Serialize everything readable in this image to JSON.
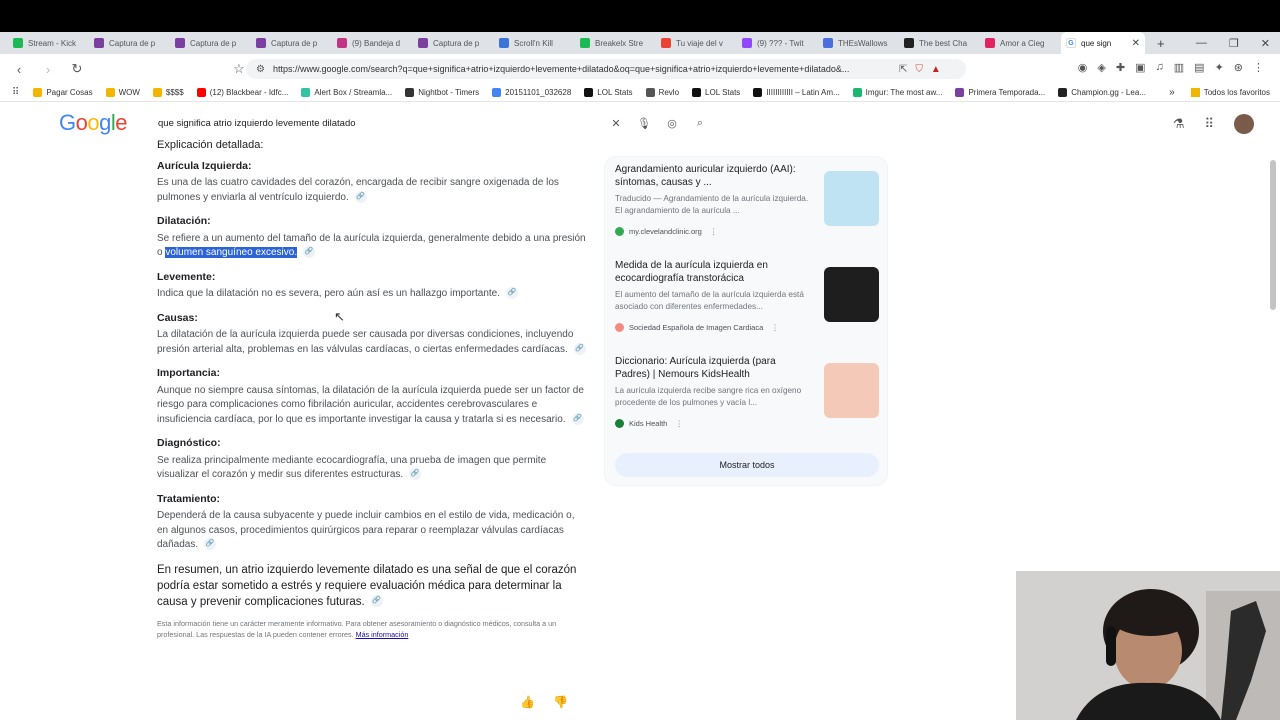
{
  "browser": {
    "tabs": [
      {
        "label": "Stream - Kick",
        "color": "#1db954"
      },
      {
        "label": "Captura de p",
        "color": "#7b3fa0"
      },
      {
        "label": "Captura de p",
        "color": "#7b3fa0"
      },
      {
        "label": "Captura de p",
        "color": "#7b3fa0"
      },
      {
        "label": "(9) Bandeja d",
        "color": "#c13584"
      },
      {
        "label": "Captura de p",
        "color": "#7b3fa0"
      },
      {
        "label": "Scroll'n Kill",
        "color": "#3b73d6"
      },
      {
        "label": "Breakelx Stre",
        "color": "#1db954"
      },
      {
        "label": "Tu viaje del v",
        "color": "#ea4335"
      },
      {
        "label": "(9) ??? - Twit",
        "color": "#9146ff"
      },
      {
        "label": "THEsWallows",
        "color": "#4a6ee0"
      },
      {
        "label": "The best Cha",
        "color": "#222222"
      },
      {
        "label": "Amor a Cieg",
        "color": "#e0245e"
      }
    ],
    "active_tab": {
      "label": "que sign",
      "close": "✕"
    },
    "new_tab": "+",
    "window_controls": [
      "—",
      "❐",
      "✕"
    ],
    "url": "https://www.google.com/search?q=que+significa+atrio+izquierdo+levemente+dilatado&oq=que+significa+atrio+izquierdo+levemente+dilatado&...",
    "bookmarks": [
      {
        "label": "Pagar Cosas",
        "color": "#f2b500"
      },
      {
        "label": "WOW",
        "color": "#f2b500"
      },
      {
        "label": "$$$$",
        "color": "#f2b500"
      },
      {
        "label": "(12) Blackbear - Idfc...",
        "color": "#ff0000"
      },
      {
        "label": "Alert Box / Streamla...",
        "color": "#31c3a2"
      },
      {
        "label": "Nightbot - Timers",
        "color": "#333333"
      },
      {
        "label": "20151101_032628",
        "color": "#4285f4"
      },
      {
        "label": "LOL Stats",
        "color": "#111111"
      },
      {
        "label": "Revlo",
        "color": "#555555"
      },
      {
        "label": "LOL Stats",
        "color": "#111111"
      },
      {
        "label": "IIIIIIIIIIII – Latin Am...",
        "color": "#111111"
      },
      {
        "label": "Imgur: The most aw...",
        "color": "#1bb76e"
      },
      {
        "label": "Primera Temporada...",
        "color": "#7b3fa0"
      },
      {
        "label": "Champion.gg - Lea...",
        "color": "#222222"
      }
    ],
    "bookmarks_more": "»",
    "all_bookmarks": "Todos los favoritos"
  },
  "google": {
    "logo": [
      "G",
      "o",
      "o",
      "g",
      "l",
      "e"
    ],
    "query": "que significa atrio izquierdo levemente dilatado"
  },
  "answer": {
    "heading": "Explicación detallada:",
    "sections": [
      {
        "title": "Aurícula Izquierda:",
        "text": "Es una de las cuatro cavidades del corazón, encargada de recibir sangre oxigenada de los pulmones y enviarla al ventrículo izquierdo."
      },
      {
        "title": "Dilatación:",
        "text": "Se refiere a un aumento del tamaño de la aurícula izquierda, generalmente debido a una presión o ",
        "highlight": "volumen sanguíneo excesivo."
      },
      {
        "title": "Levemente:",
        "text": "Indica que la dilatación no es severa, pero aún así es un hallazgo importante."
      },
      {
        "title": "Causas:",
        "text": "La dilatación de la aurícula izquierda puede ser causada por diversas condiciones, incluyendo presión arterial alta, problemas en las válvulas cardíacas, o ciertas enfermedades cardíacas."
      },
      {
        "title": "Importancia:",
        "text": "Aunque no siempre causa síntomas, la dilatación de la aurícula izquierda puede ser un factor de riesgo para complicaciones como fibrilación auricular, accidentes cerebrovasculares e insuficiencia cardíaca, por lo que es importante investigar la causa y tratarla si es necesario."
      },
      {
        "title": "Diagnóstico:",
        "text": "Se realiza principalmente mediante ecocardiografía, una prueba de imagen que permite visualizar el corazón y medir sus diferentes estructuras."
      },
      {
        "title": "Tratamiento:",
        "text": "Dependerá de la causa subyacente y puede incluir cambios en el estilo de vida, medicación o, en algunos casos, procedimientos quirúrgicos para reparar o reemplazar válvulas cardíacas dañadas."
      }
    ],
    "summary": "En resumen, un atrio izquierdo levemente dilatado es una señal de que el corazón podría estar sometido a estrés y requiere evaluación médica para determinar la causa y prevenir complicaciones futuras.",
    "disclaimer": "Esta información tiene un carácter meramente informativo. Para obtener asesoramiento o diagnóstico médicos, consulta a un profesional. Las respuestas de la IA pueden contener errores.",
    "disclaimer_link": "Más información"
  },
  "sources": {
    "cards": [
      {
        "title": "Agrandamiento auricular izquierdo (AAI): síntomas, causas y ...",
        "snippet": "Traducido — Agrandamiento de la aurícula izquierda. El agrandamiento de la aurícula ...",
        "source": "my.clevelandclinic.org",
        "dot_color": "#34a853",
        "thumb_color": "#bfe3f2"
      },
      {
        "title": "Medida de la aurícula izquierda en ecocardiografía transtorácica",
        "snippet": "El aumento del tamaño de la aurícula izquierda está asociado con diferentes enfermedades...",
        "source": "Sociedad Española de Imagen Cardiaca",
        "dot_color": "#f28b82",
        "thumb_color": "#1e1e1e"
      },
      {
        "title": "Diccionario: Aurícula izquierda (para Padres) | Nemours KidsHealth",
        "snippet": "La aurícula izquierda recibe sangre rica en oxígeno procedente de los pulmones y vacía l...",
        "source": "Kids Health",
        "dot_color": "#188038",
        "thumb_color": "#f5c9b8"
      }
    ],
    "show_all": "Mostrar todos"
  }
}
